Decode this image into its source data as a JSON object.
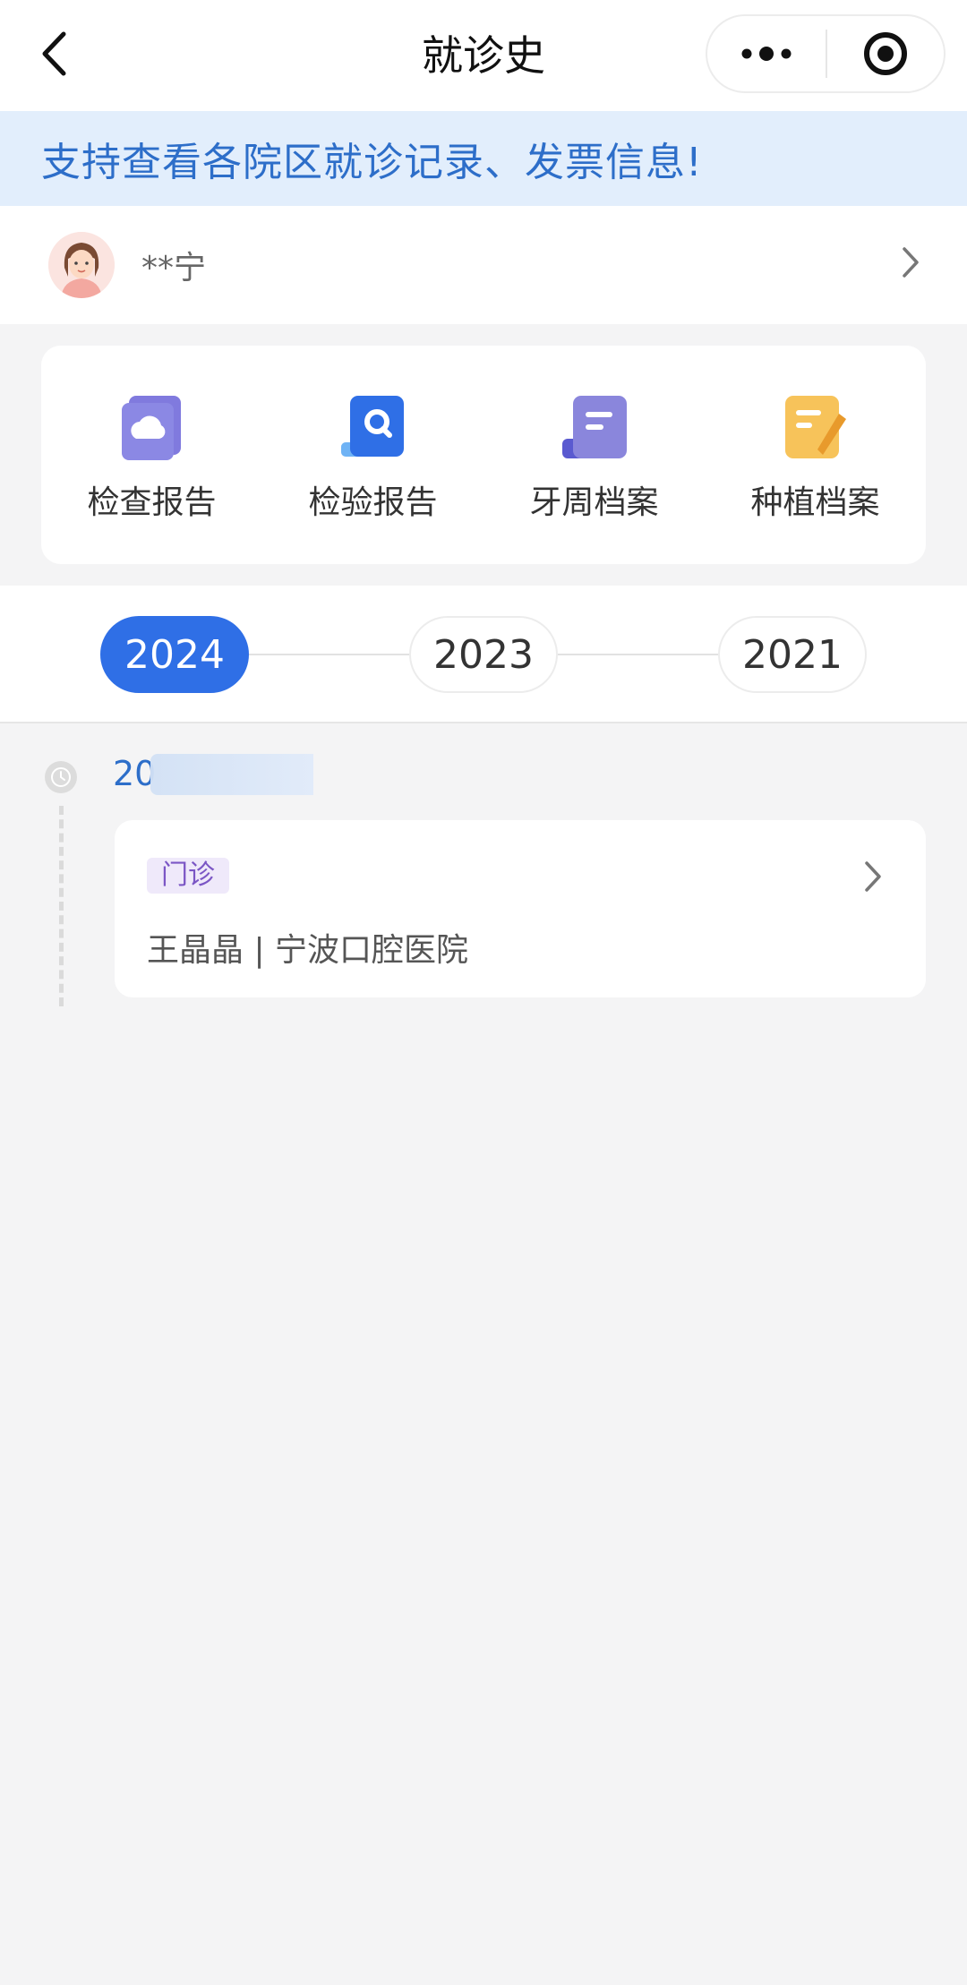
{
  "header": {
    "title": "就诊史",
    "back_icon": "chevron-left-icon",
    "more_icon": "more-dots-icon",
    "target_icon": "target-icon"
  },
  "banner": {
    "text": "支持查看各院区就诊记录、发票信息!"
  },
  "patient": {
    "name": "**宁",
    "avatar_icon": "female-avatar-icon"
  },
  "shortcuts": [
    {
      "label": "检查报告",
      "icon": "cloud-doc-icon",
      "color": "#6b7bdc"
    },
    {
      "label": "检验报告",
      "icon": "search-doc-icon",
      "color": "#2f6fe6"
    },
    {
      "label": "牙周档案",
      "icon": "file-list-icon",
      "color": "#7f7fd6"
    },
    {
      "label": "种植档案",
      "icon": "note-edit-icon",
      "color": "#f5b84a"
    }
  ],
  "years": [
    {
      "label": "2024",
      "active": true
    },
    {
      "label": "2023",
      "active": false
    },
    {
      "label": "2021",
      "active": false
    }
  ],
  "timeline": {
    "date_text": "20"
  },
  "record": {
    "tag": "门诊",
    "info": "王晶晶 | 宁波口腔医院"
  },
  "colors": {
    "accent": "#2f6fe6",
    "banner_bg": "#e2eefc",
    "banner_text": "#2d6ec9",
    "tag_bg": "#efe9fa",
    "tag_text": "#7b56c5"
  }
}
